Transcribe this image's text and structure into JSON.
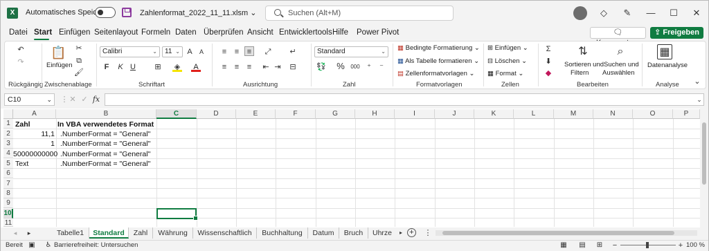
{
  "titlebar": {
    "autosave_label": "Automatisches Speichern",
    "filename": "Zahlenformat_2022_11_11.xlsm",
    "search_placeholder": "Suchen (Alt+M)"
  },
  "ribbon_tabs": [
    "Datei",
    "Start",
    "Einfügen",
    "Seitenlayout",
    "Formeln",
    "Daten",
    "Überprüfen",
    "Ansicht",
    "Entwicklertools",
    "Hilfe",
    "Power Pivot"
  ],
  "buttons": {
    "kommentare": "Kommentare",
    "freigeben": "Freigeben"
  },
  "ribbon": {
    "groups": {
      "rueckgaengig": "Rückgängig",
      "zwischenablage": "Zwischenablage",
      "schriftart": "Schriftart",
      "ausrichtung": "Ausrichtung",
      "zahl": "Zahl",
      "formatvorlagen": "Formatvorlagen",
      "zellen": "Zellen",
      "bearbeiten": "Bearbeiten",
      "analyse": "Analyse"
    },
    "einfuegen_label": "Einfügen",
    "font_name": "Calibri",
    "font_size": "11",
    "number_format": "Standard",
    "bedingte": "Bedingte Formatierung",
    "als_tabelle": "Als Tabelle formatieren",
    "zellenformat": "Zellenformatvorlagen",
    "einfuegen_cells": "Einfügen",
    "loeschen": "Löschen",
    "format": "Format",
    "sortieren_1": "Sortieren und",
    "sortieren_2": "Filtern",
    "suchen_1": "Suchen und",
    "suchen_2": "Auswählen",
    "datenanalyse": "Datenanalyse",
    "bold_glyph": "F",
    "italic_glyph": "K",
    "underline_glyph": "U",
    "percent_glyph": "%",
    "thousands_glyph": "000"
  },
  "formula_bar": {
    "name_box": "C10",
    "fx": "fx",
    "formula": ""
  },
  "columns": [
    "A",
    "B",
    "C",
    "D",
    "E",
    "F",
    "G",
    "H",
    "I",
    "J",
    "K",
    "L",
    "M",
    "N",
    "O",
    "P"
  ],
  "selected_column": "C",
  "rows": [
    "1",
    "2",
    "3",
    "4",
    "5",
    "6",
    "7",
    "8",
    "9",
    "10",
    "11"
  ],
  "selected_row": "10",
  "cells": {
    "A1": "Zahl",
    "B1": "In VBA verwendetes Format",
    "A2": "11,1",
    "B2": ".NumberFormat = \"General\"",
    "A3": "1",
    "B3": ".NumberFormat = \"General\"",
    "A4": "50000000000",
    "B4": ".NumberFormat = \"General\"",
    "A5": "Text",
    "B5": ".NumberFormat = \"General\""
  },
  "sheet_tabs": [
    "Tabelle1",
    "Standard",
    "Zahl",
    "Währung",
    "Wissenschaftlich",
    "Buchhaltung",
    "Datum",
    "Bruch",
    "Uhrze"
  ],
  "active_sheet": "Standard",
  "status": {
    "ready": "Bereit",
    "accessibility": "Barrierefreiheit: Untersuchen",
    "zoom": "100 %"
  },
  "colors": {
    "accent": "#107c41",
    "save_icon": "#8c3b9e"
  }
}
